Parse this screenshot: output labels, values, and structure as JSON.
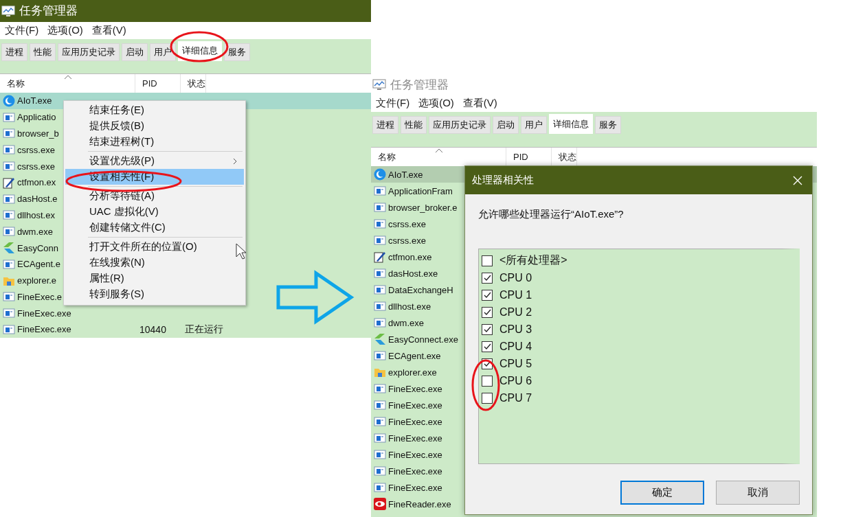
{
  "left_window": {
    "title": "任务管理器",
    "active": true,
    "menu": [
      "文件(F)",
      "选项(O)",
      "查看(V)"
    ],
    "tabs": [
      {
        "label": "进程",
        "selected": false
      },
      {
        "label": "性能",
        "selected": false
      },
      {
        "label": "应用历史记录",
        "selected": false
      },
      {
        "label": "启动",
        "selected": false
      },
      {
        "label": "用户",
        "selected": false
      },
      {
        "label": "详细信息",
        "selected": true
      },
      {
        "label": "服务",
        "selected": false
      }
    ],
    "columns": [
      "名称",
      "PID",
      "状态"
    ],
    "rows": [
      {
        "name": "AIoT.exe",
        "kind": "aiot",
        "selected": true
      },
      {
        "name": "Applicatio",
        "kind": "app",
        "selected": false
      },
      {
        "name": "browser_b",
        "kind": "app",
        "selected": false
      },
      {
        "name": "csrss.exe",
        "kind": "app",
        "selected": false
      },
      {
        "name": "csrss.exe",
        "kind": "app",
        "selected": false
      },
      {
        "name": "ctfmon.ex",
        "kind": "pen",
        "selected": false
      },
      {
        "name": "dasHost.e",
        "kind": "app",
        "selected": false
      },
      {
        "name": "dllhost.ex",
        "kind": "app",
        "selected": false
      },
      {
        "name": "dwm.exe",
        "kind": "app",
        "selected": false
      },
      {
        "name": "EasyConn",
        "kind": "easy",
        "selected": false
      },
      {
        "name": "ECAgent.e",
        "kind": "app",
        "selected": false
      },
      {
        "name": "explorer.e",
        "kind": "folder",
        "selected": false
      },
      {
        "name": "FineExec.e",
        "kind": "app",
        "selected": false
      },
      {
        "name": "FineExec.exe",
        "kind": "app",
        "selected": false
      },
      {
        "name": "FineExec.exe",
        "pid": "10440",
        "status": "正在运行",
        "kind": "app",
        "selected": false
      }
    ],
    "context_menu": [
      {
        "kind": "item",
        "label": "结束任务(E)",
        "selected": false,
        "submenu": false
      },
      {
        "kind": "item",
        "label": "提供反馈(B)",
        "selected": false,
        "submenu": false
      },
      {
        "kind": "item",
        "label": "结束进程树(T)",
        "selected": false,
        "submenu": false
      },
      {
        "kind": "separator"
      },
      {
        "kind": "item",
        "label": "设置优先级(P)",
        "selected": false,
        "submenu": true
      },
      {
        "kind": "item",
        "label": "设置相关性(F)",
        "selected": true,
        "submenu": false
      },
      {
        "kind": "separator"
      },
      {
        "kind": "item",
        "label": "分析等待链(A)",
        "selected": false,
        "submenu": false
      },
      {
        "kind": "item",
        "label": "UAC 虚拟化(V)",
        "selected": false,
        "submenu": false
      },
      {
        "kind": "item",
        "label": "创建转储文件(C)",
        "selected": false,
        "submenu": false
      },
      {
        "kind": "separator"
      },
      {
        "kind": "item",
        "label": "打开文件所在的位置(O)",
        "selected": false,
        "submenu": false
      },
      {
        "kind": "item",
        "label": "在线搜索(N)",
        "selected": false,
        "submenu": false
      },
      {
        "kind": "item",
        "label": "属性(R)",
        "selected": false,
        "submenu": false
      },
      {
        "kind": "item",
        "label": "转到服务(S)",
        "selected": false,
        "submenu": false
      }
    ]
  },
  "right_window": {
    "title": "任务管理器",
    "active": false,
    "menu": [
      "文件(F)",
      "选项(O)",
      "查看(V)"
    ],
    "tabs": [
      {
        "label": "进程",
        "selected": false
      },
      {
        "label": "性能",
        "selected": false
      },
      {
        "label": "应用历史记录",
        "selected": false
      },
      {
        "label": "启动",
        "selected": false
      },
      {
        "label": "用户",
        "selected": false
      },
      {
        "label": "详细信息",
        "selected": true
      },
      {
        "label": "服务",
        "selected": false
      }
    ],
    "columns": [
      "名称",
      "PID",
      "状态"
    ],
    "rows": [
      {
        "name": "AIoT.exe",
        "kind": "aiot",
        "selected": true
      },
      {
        "name": "ApplicationFram",
        "kind": "app",
        "selected": false
      },
      {
        "name": "browser_broker.e",
        "kind": "app",
        "selected": false
      },
      {
        "name": "csrss.exe",
        "kind": "app",
        "selected": false
      },
      {
        "name": "csrss.exe",
        "kind": "app",
        "selected": false
      },
      {
        "name": "ctfmon.exe",
        "kind": "pen",
        "selected": false
      },
      {
        "name": "dasHost.exe",
        "kind": "app",
        "selected": false
      },
      {
        "name": "DataExchangeH",
        "kind": "app",
        "selected": false
      },
      {
        "name": "dllhost.exe",
        "kind": "app",
        "selected": false
      },
      {
        "name": "dwm.exe",
        "kind": "app",
        "selected": false
      },
      {
        "name": "EasyConnect.exe",
        "kind": "easy",
        "selected": false
      },
      {
        "name": "ECAgent.exe",
        "kind": "app",
        "selected": false
      },
      {
        "name": "explorer.exe",
        "kind": "folder",
        "selected": false
      },
      {
        "name": "FineExec.exe",
        "kind": "app",
        "selected": false
      },
      {
        "name": "FineExec.exe",
        "kind": "app",
        "selected": false
      },
      {
        "name": "FineExec.exe",
        "kind": "app",
        "selected": false
      },
      {
        "name": "FineExec.exe",
        "kind": "app",
        "selected": false
      },
      {
        "name": "FineExec.exe",
        "kind": "app",
        "selected": false
      },
      {
        "name": "FineExec.exe",
        "kind": "app",
        "selected": false
      },
      {
        "name": "FineExec.exe",
        "kind": "app",
        "selected": false
      },
      {
        "name": "FineReader.exe",
        "kind": "reader",
        "selected": false
      }
    ],
    "dialog": {
      "title": "处理器相关性",
      "question": "允许哪些处理器运行“AIoT.exe”?",
      "processors": [
        {
          "label": "<所有处理器>",
          "checked": false
        },
        {
          "label": "CPU 0",
          "checked": true
        },
        {
          "label": "CPU 1",
          "checked": true
        },
        {
          "label": "CPU 2",
          "checked": true
        },
        {
          "label": "CPU 3",
          "checked": true
        },
        {
          "label": "CPU 4",
          "checked": true
        },
        {
          "label": "CPU 5",
          "checked": true
        },
        {
          "label": "CPU 6",
          "checked": false
        },
        {
          "label": "CPU 7",
          "checked": false
        }
      ],
      "buttons": [
        {
          "label": "确定",
          "default": true
        },
        {
          "label": "取消",
          "default": false
        }
      ]
    }
  }
}
